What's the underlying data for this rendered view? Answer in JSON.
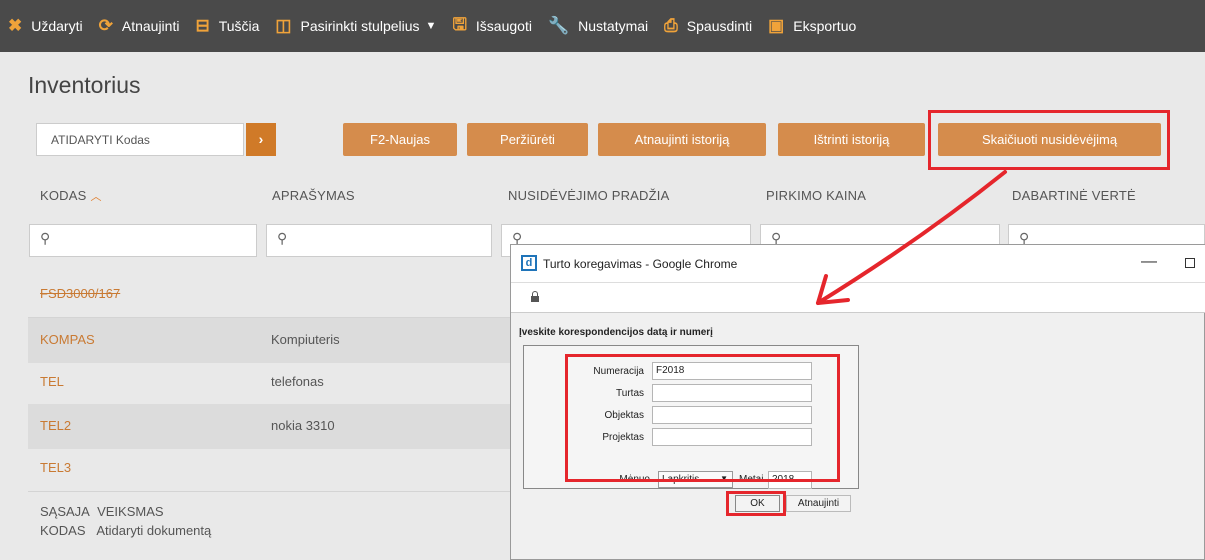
{
  "toolbar": {
    "items": [
      {
        "label": "Uždaryti",
        "icon": "close-icon"
      },
      {
        "label": "Atnaujinti",
        "icon": "refresh-icon"
      },
      {
        "label": "Tuščia",
        "icon": "empty-icon"
      },
      {
        "label": "Pasirinkti stulpelius",
        "icon": "columns-icon"
      },
      {
        "label": "Išsaugoti",
        "icon": "save-icon"
      },
      {
        "label": "Nustatymai",
        "icon": "wrench-icon"
      },
      {
        "label": "Spausdinti",
        "icon": "print-icon"
      },
      {
        "label": "Eksportuo",
        "icon": "export-icon"
      }
    ]
  },
  "page": {
    "title": "Inventorius",
    "search_placeholder": "ATIDARYTI Kodas",
    "buttons": {
      "new": "F2-Naujas",
      "view": "Peržiūrėti",
      "refresh_history": "Atnaujinti istoriją",
      "delete_history": "Ištrinti istoriją",
      "calc_depreciation": "Skaičiuoti nusidėvėjimą"
    },
    "columns": {
      "code": "KODAS",
      "description": "APRAŠYMAS",
      "depreciation_start": "NUSIDĖVĖJIMO PRADŽIA",
      "purchase_price": "PIRKIMO KAINA",
      "current_value": "DABARTINĖ VERTĖ"
    },
    "rows": [
      {
        "code": "FSD3000/167",
        "description": ""
      },
      {
        "code": "KOMPAS",
        "description": "Kompiuteris"
      },
      {
        "code": "TEL",
        "description": "telefonas"
      },
      {
        "code": "TEL2",
        "description": "nokia 3310"
      },
      {
        "code": "TEL3",
        "description": ""
      }
    ],
    "footer": {
      "line1_a": "SĄSAJA",
      "line1_b": "VEIKSMAS",
      "line2_a": "KODAS",
      "line2_b": "Atidaryti dokumentą"
    }
  },
  "popup": {
    "title": "Turto koregavimas - Google Chrome",
    "logo": "d",
    "prompt": "Įveskite korespondencijos datą ir numerį",
    "fields": {
      "numeracija_label": "Numeracija",
      "numeracija_value": "F2018",
      "turtas_label": "Turtas",
      "turtas_value": "",
      "objektas_label": "Objektas",
      "objektas_value": "",
      "projektas_label": "Projektas",
      "projektas_value": "",
      "menuo_label": "Mėnuo",
      "menuo_value": "Lapkritis",
      "metai_label": "Metai",
      "metai_value": "2018"
    },
    "ok_label": "OK",
    "refresh_label": "Atnaujinti"
  },
  "colors": {
    "accent": "#d58c4c",
    "highlight": "#e5262c",
    "toolbar_bg": "#4a4a4a",
    "link": "#c97a33"
  }
}
